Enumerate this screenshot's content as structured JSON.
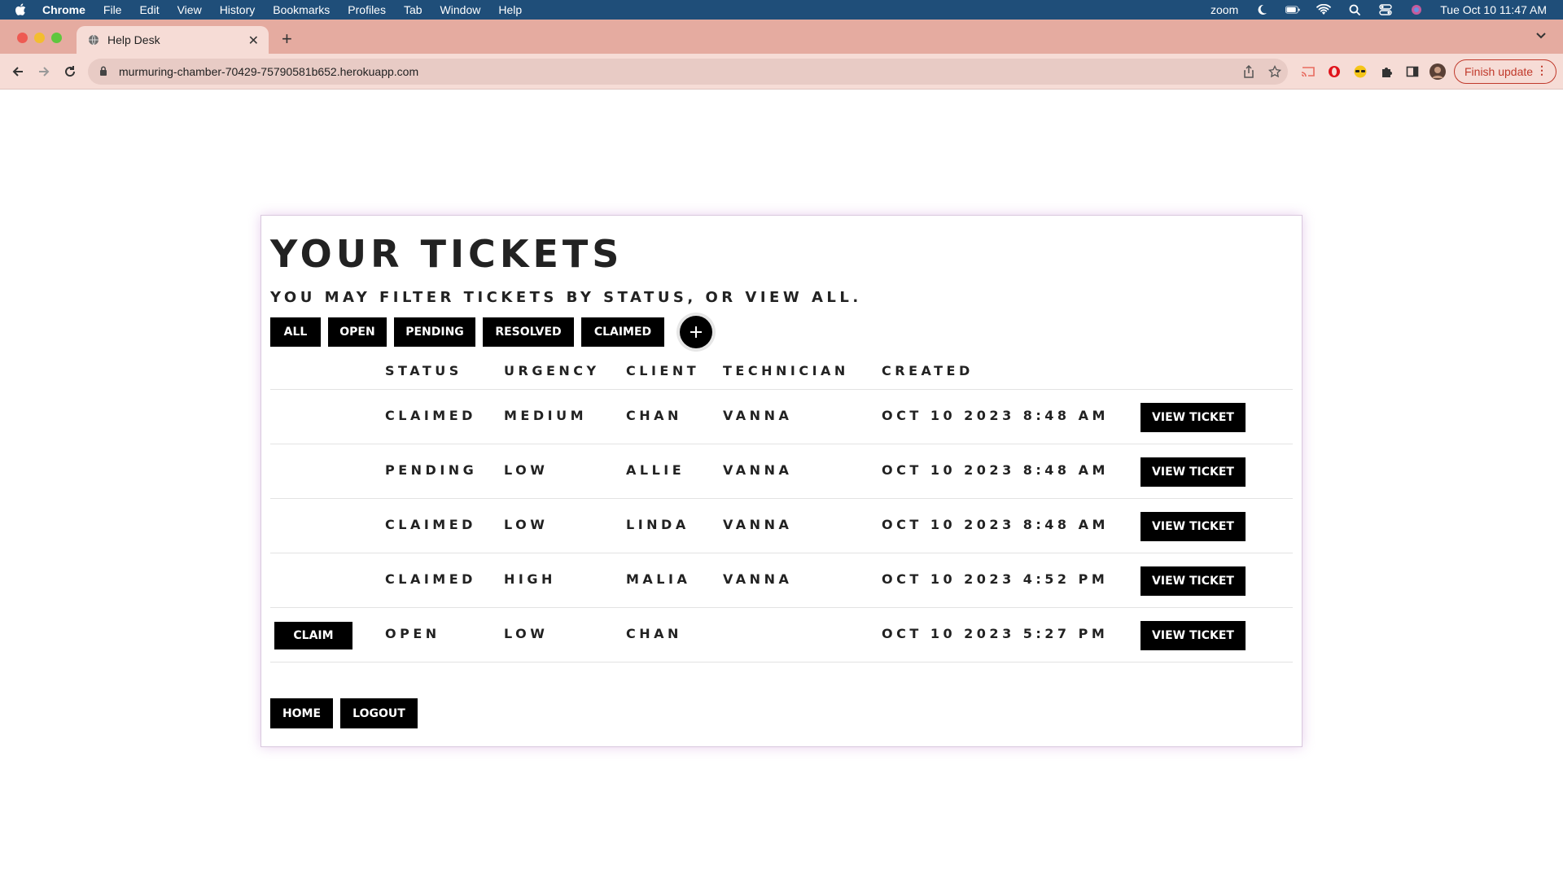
{
  "menubar": {
    "app": "Chrome",
    "items": [
      "File",
      "Edit",
      "View",
      "History",
      "Bookmarks",
      "Profiles",
      "Tab",
      "Window",
      "Help"
    ],
    "zoom": "zoom",
    "datetime": "Tue Oct 10  11:47 AM"
  },
  "browser": {
    "tab_title": "Help Desk",
    "url": "murmuring-chamber-70429-75790581b652.herokuapp.com",
    "finish_update": "Finish update"
  },
  "page": {
    "title": "YOUR TICKETS",
    "subtitle": "YOU MAY FILTER TICKETS BY STATUS, OR VIEW ALL.",
    "filters": [
      "ALL",
      "OPEN",
      "PENDING",
      "RESOLVED",
      "CLAIMED"
    ],
    "columns": [
      "STATUS",
      "URGENCY",
      "CLIENT",
      "TECHNICIAN",
      "CREATED"
    ],
    "view_label": "VIEW TICKET",
    "claim_label": "CLAIM",
    "rows": [
      {
        "status": "CLAIMED",
        "urgency": "MEDIUM",
        "client": "CHAN",
        "technician": "VANNA",
        "created": "OCT 10 2023 8:48 AM"
      },
      {
        "status": "PENDING",
        "urgency": "LOW",
        "client": "ALLIE",
        "technician": "VANNA",
        "created": "OCT 10 2023 8:48 AM"
      },
      {
        "status": "CLAIMED",
        "urgency": "LOW",
        "client": "LINDA",
        "technician": "VANNA",
        "created": "OCT 10 2023 8:48 AM"
      },
      {
        "status": "CLAIMED",
        "urgency": "HIGH",
        "client": "MALIA",
        "technician": "VANNA",
        "created": "OCT 10 2023 4:52 PM"
      },
      {
        "status": "OPEN",
        "urgency": "LOW",
        "client": "CHAN",
        "technician": "",
        "created": "OCT 10 2023 5:27 PM"
      }
    ],
    "home_label": "HOME",
    "logout_label": "LOGOUT"
  }
}
